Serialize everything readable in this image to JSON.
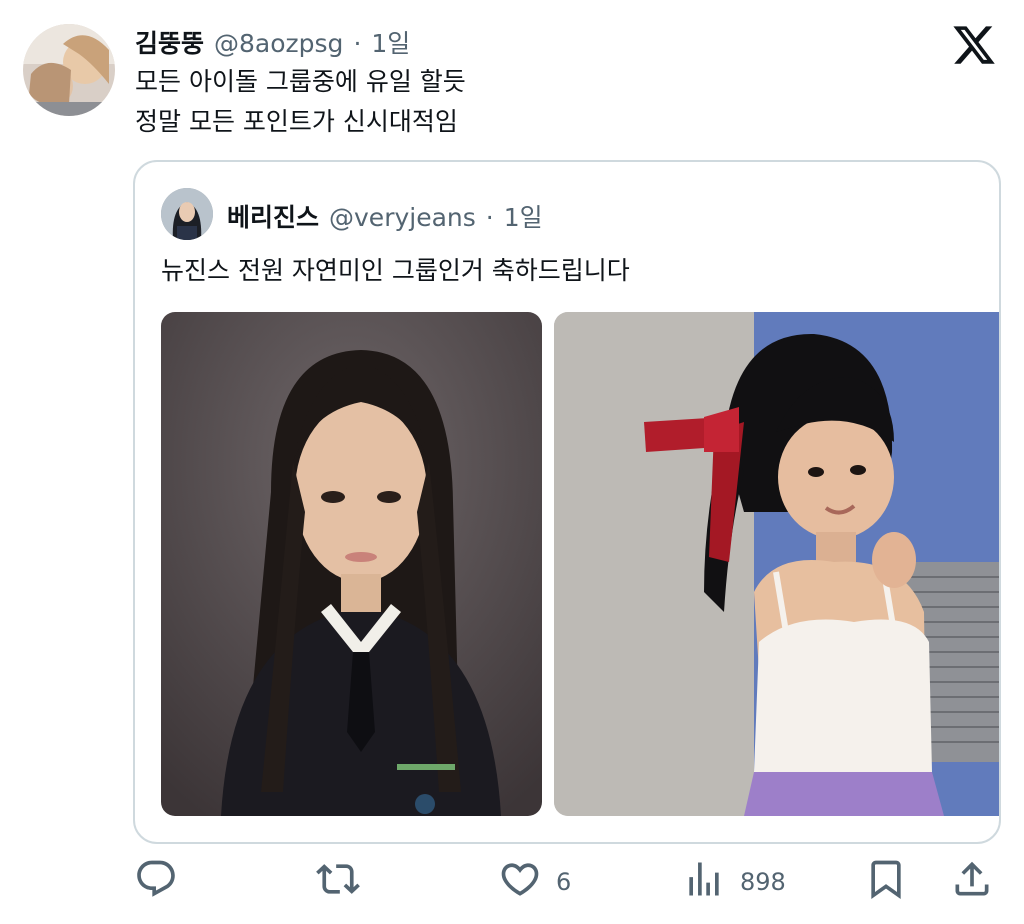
{
  "tweet": {
    "display_name": "김뚱뚱",
    "handle": "@8aozpsg",
    "separator": "·",
    "time": "1일",
    "text": "모든 아이돌 그룹중에 유일 할듯\n정말 모든 포인트가 신시대적임",
    "avatar_icon": "user-avatar-photo"
  },
  "quote": {
    "display_name": "베리진스",
    "handle": "@veryjeans",
    "separator": "·",
    "time": "1일",
    "text": "뉴진스 전원 자연미인 그룹인거 축하드립니다",
    "images": [
      {
        "name": "yearbook-portrait-photo"
      },
      {
        "name": "child-red-ribbon-photo"
      }
    ]
  },
  "actions": {
    "reply_icon": "reply-icon",
    "retweet_icon": "retweet-icon",
    "like_icon": "heart-icon",
    "like_count": "6",
    "views_icon": "views-icon",
    "views_count": "898",
    "bookmark_icon": "bookmark-icon",
    "share_icon": "share-icon"
  },
  "colors": {
    "text": "#0f1419",
    "muted": "#536471",
    "border": "#cfd9de"
  }
}
